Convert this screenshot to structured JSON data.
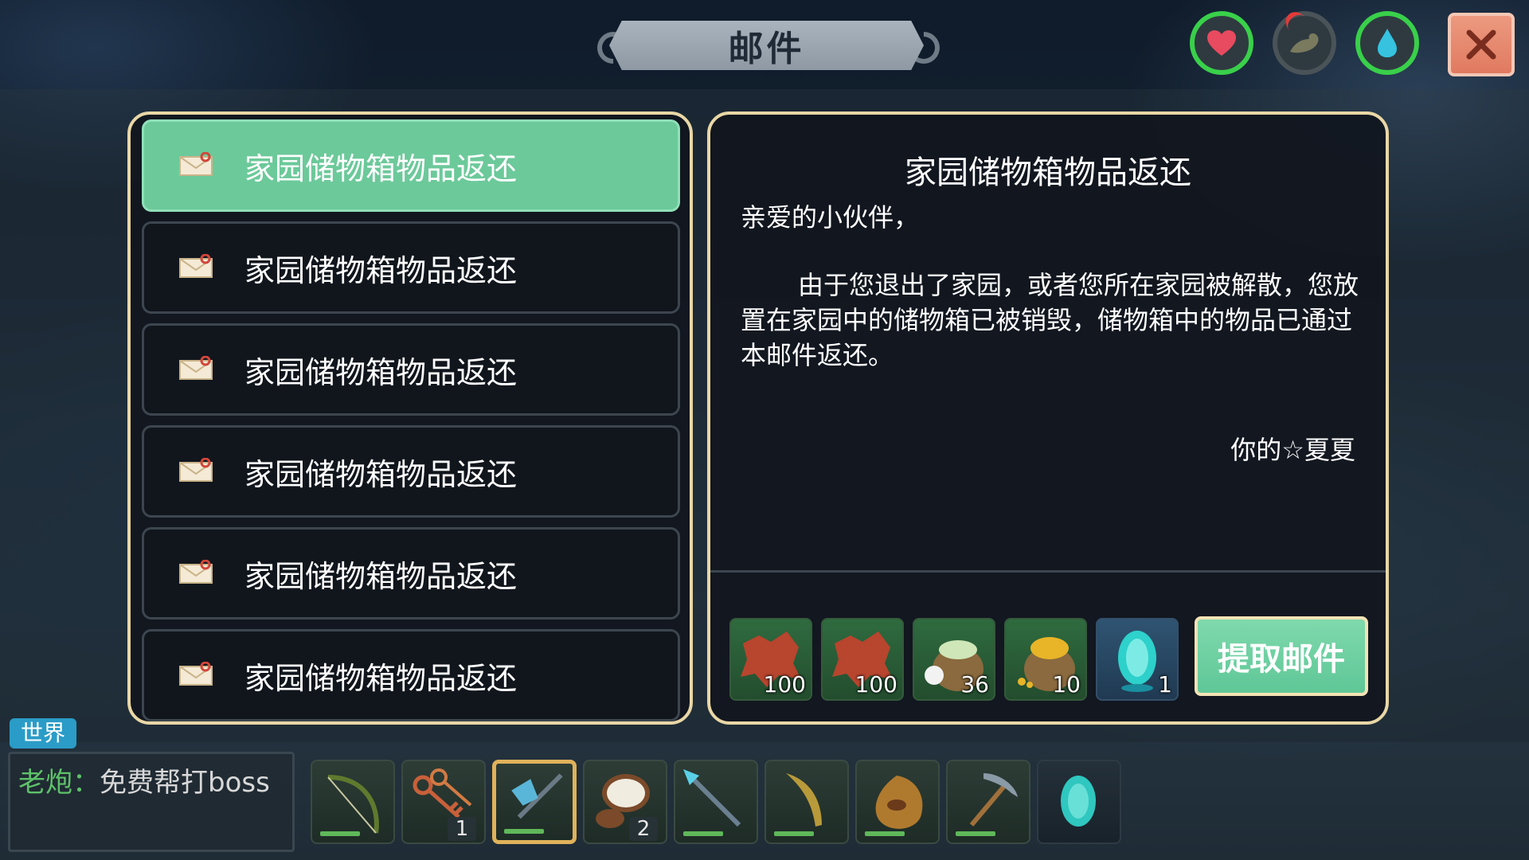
{
  "window": {
    "title": "邮件",
    "close_label": "✕"
  },
  "status_icons": [
    {
      "name": "heart-icon",
      "color": "#e84a5f"
    },
    {
      "name": "hunger-icon",
      "color": "#7a7a66"
    },
    {
      "name": "water-drop-icon",
      "color": "#35c3e0"
    }
  ],
  "mail_list": {
    "items": [
      {
        "label": "家园储物箱物品返还",
        "selected": true
      },
      {
        "label": "家园储物箱物品返还",
        "selected": false
      },
      {
        "label": "家园储物箱物品返还",
        "selected": false
      },
      {
        "label": "家园储物箱物品返还",
        "selected": false
      },
      {
        "label": "家园储物箱物品返还",
        "selected": false
      },
      {
        "label": "家园储物箱物品返还",
        "selected": false
      }
    ]
  },
  "mail_detail": {
    "title": "家园储物箱物品返还",
    "greeting": "亲爱的小伙伴，",
    "body": "由于您退出了家园，或者您所在家园被解散，您放置在家园中的储物箱已被销毁，储物箱中的物品已通过本邮件返还。",
    "signature": "你的☆夏夏",
    "attachments": [
      {
        "name": "leather-hide-icon",
        "qty": "100"
      },
      {
        "name": "leather-hide-icon",
        "qty": "100"
      },
      {
        "name": "cotton-seed-sack-icon",
        "qty": "36"
      },
      {
        "name": "gold-grain-sack-icon",
        "qty": "10"
      },
      {
        "name": "crystal-portal-stone-icon",
        "qty": "1"
      }
    ],
    "claim_label": "提取邮件"
  },
  "chat": {
    "channel": "世界",
    "user": "老炮：",
    "message": "免费帮打boss"
  },
  "hotbar": [
    {
      "name": "bow-icon",
      "qty": ""
    },
    {
      "name": "keys-icon",
      "qty": "1"
    },
    {
      "name": "crystal-axe-icon",
      "qty": "",
      "selected": true
    },
    {
      "name": "coconut-icon",
      "qty": "2"
    },
    {
      "name": "crystal-spear-icon",
      "qty": ""
    },
    {
      "name": "curved-blade-icon",
      "qty": ""
    },
    {
      "name": "water-flask-icon",
      "qty": ""
    },
    {
      "name": "pickaxe-icon",
      "qty": ""
    },
    {
      "name": "crystal-stone-icon",
      "qty": ""
    }
  ]
}
